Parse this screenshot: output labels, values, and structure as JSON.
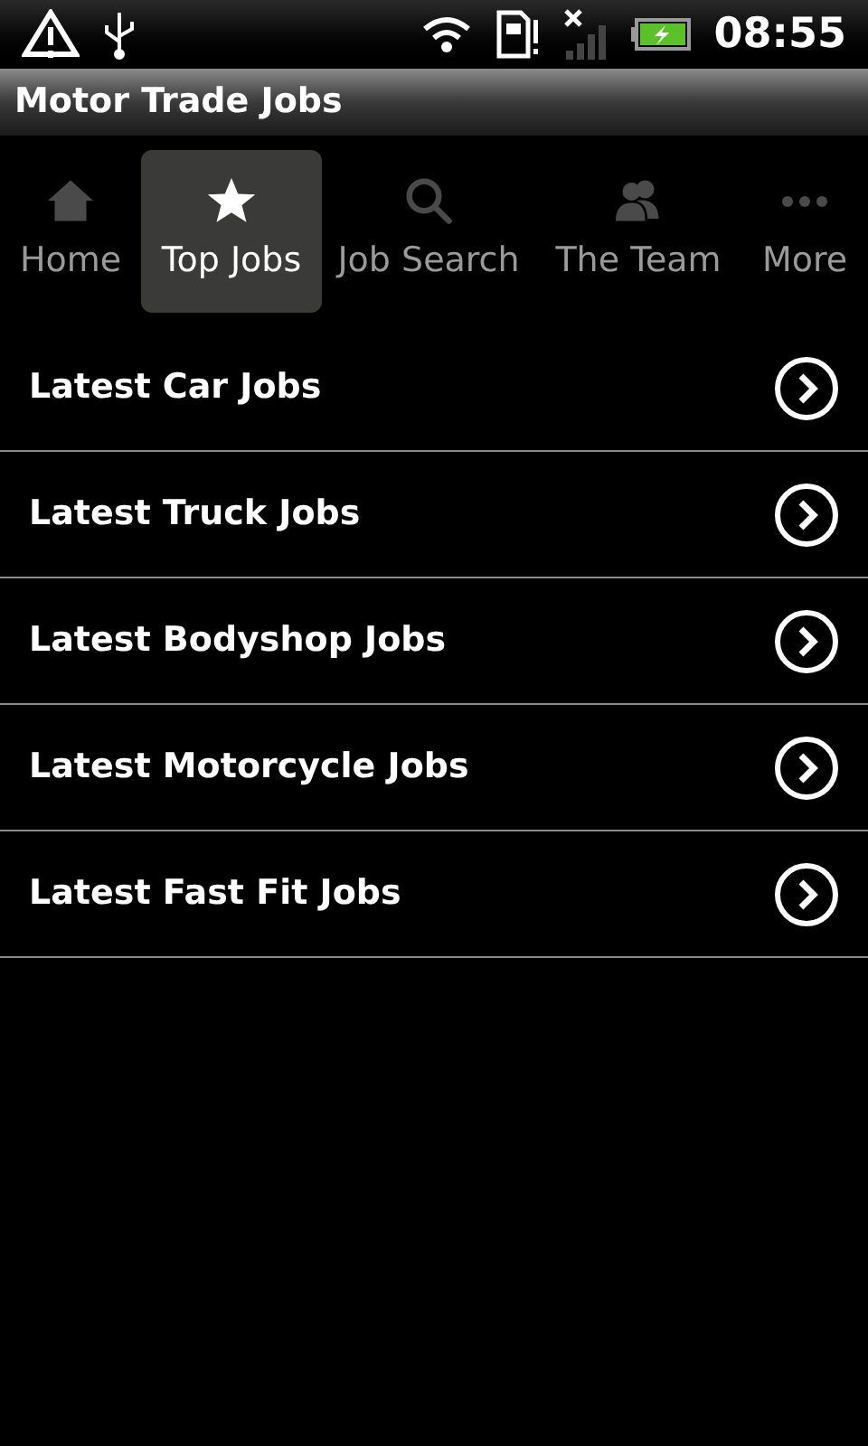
{
  "status_bar": {
    "time": "08:55"
  },
  "window": {
    "title": "Motor Trade Jobs"
  },
  "tabs": [
    {
      "label": "Home",
      "kind": "home",
      "selected": false
    },
    {
      "label": "Top Jobs",
      "kind": "star",
      "selected": true
    },
    {
      "label": "Job Search",
      "kind": "search",
      "selected": false
    },
    {
      "label": "The Team",
      "kind": "team",
      "selected": false
    },
    {
      "label": "More",
      "kind": "more",
      "selected": false
    }
  ],
  "list": [
    {
      "label": "Latest Car Jobs"
    },
    {
      "label": "Latest Truck Jobs"
    },
    {
      "label": "Latest Bodyshop Jobs"
    },
    {
      "label": "Latest Motorcycle Jobs"
    },
    {
      "label": "Latest Fast Fit Jobs"
    }
  ]
}
